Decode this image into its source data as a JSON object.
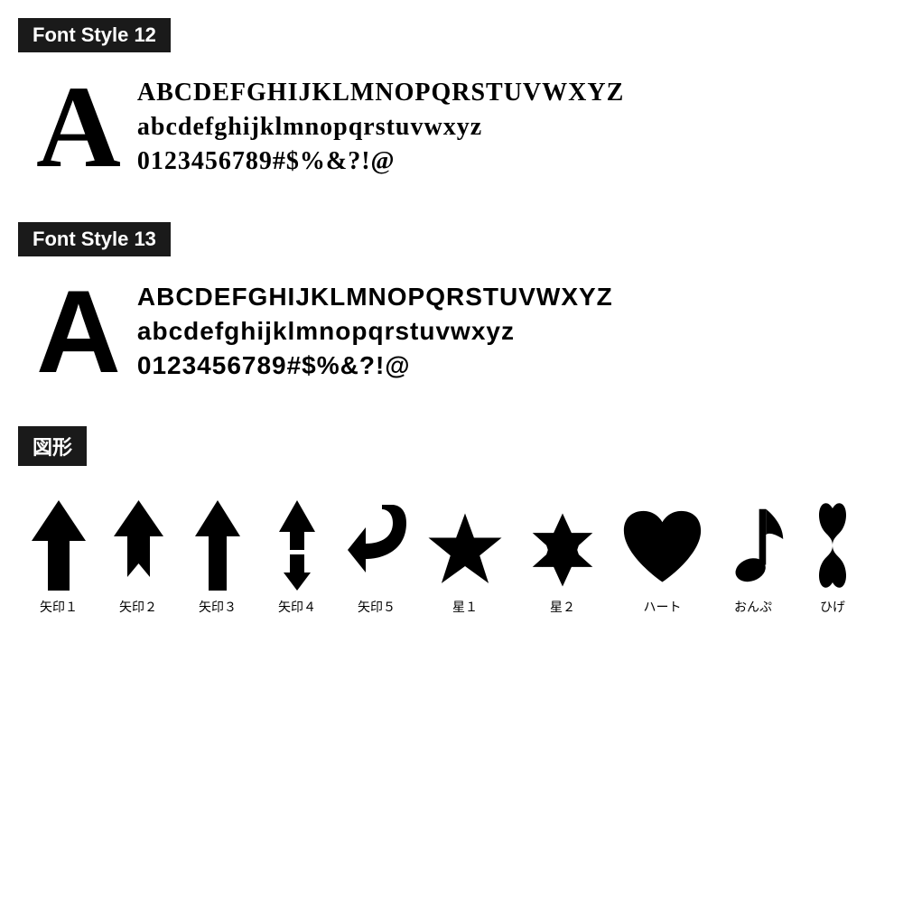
{
  "sections": [
    {
      "id": "font-style-12",
      "header": "Font Style 12",
      "big_letter": "A",
      "lines": [
        "ABCDEFGHIJKLMNOPQRSTUVWXYZ",
        "abcdefghijklmnopqrstuvwxyz",
        "0123456789#$%&?!@"
      ],
      "font_class": "font-style-12"
    },
    {
      "id": "font-style-13",
      "header": "Font Style 13",
      "big_letter": "A",
      "lines": [
        "ABCDEFGHIJKLMNOPQRSTUVWXYZ",
        "abcdefghijklmnopqrstuvwxyz",
        "0123456789#$%&?!@"
      ],
      "font_class": "font-style-13"
    }
  ],
  "shapes_header": "図形",
  "shapes": [
    {
      "id": "arrow1",
      "label": "矢印１"
    },
    {
      "id": "arrow2",
      "label": "矢印２"
    },
    {
      "id": "arrow3",
      "label": "矢印３"
    },
    {
      "id": "arrow4",
      "label": "矢印４"
    },
    {
      "id": "arrow5",
      "label": "矢印５"
    },
    {
      "id": "star1",
      "label": "星１"
    },
    {
      "id": "star2",
      "label": "星２"
    },
    {
      "id": "heart",
      "label": "ハート"
    },
    {
      "id": "note",
      "label": "おんぷ"
    },
    {
      "id": "mustache",
      "label": "ひげ"
    }
  ]
}
